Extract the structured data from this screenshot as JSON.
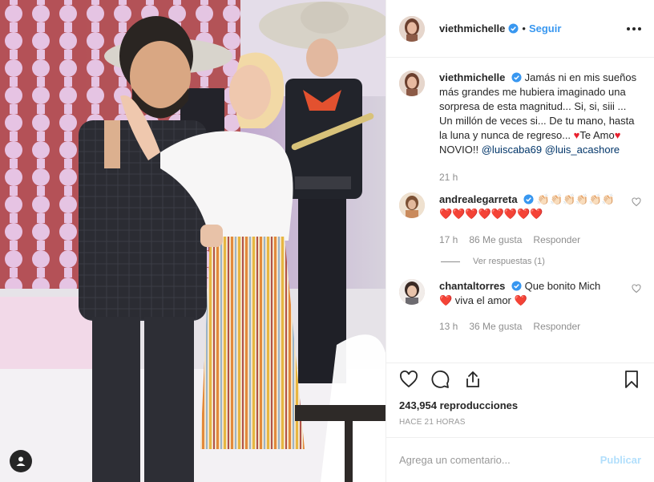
{
  "post": {
    "username": "viethmichelle",
    "follow_label": "Seguir",
    "dot": "•"
  },
  "caption": {
    "username": "viethmichelle",
    "text_1": "Jamás ni en mis sueños más grandes me hubiera imaginado una sorpresa de esta magnitud... Si, si, siii ... Un millón de veces si... De tu mano, hasta la luna y nunca de regreso... ",
    "heart_1": "♥",
    "text_2": "Te Amo",
    "heart_2": "♥",
    "text_3": " NOVIO!! ",
    "mention_1": "@luiscaba69",
    "mention_2": "@luis_acashore",
    "time": "21 h"
  },
  "comments": [
    {
      "username": "andrealegarreta",
      "text": "👏🏻👏🏻👏🏻👏🏻👏🏻👏🏻❤️❤️❤️❤️❤️❤️❤️❤️",
      "time": "17 h",
      "likes": "86 Me gusta",
      "reply_label": "Responder",
      "view_replies": "Ver respuestas (1)"
    },
    {
      "username": "chantaltorres",
      "text_1": "Que bonito Mich",
      "heart": "❤️",
      "text_2": " viva el amor ",
      "heart_2": "❤️",
      "time": "13 h",
      "likes": "36 Me gusta",
      "reply_label": "Responder"
    }
  ],
  "stats": {
    "views": "243,954 reproducciones",
    "posted": "HACE 21 HORAS"
  },
  "add_comment": {
    "placeholder": "Agrega un comentario...",
    "publish_label": "Publicar"
  },
  "icons": {
    "like": "heart-outline-icon",
    "comment": "comment-icon",
    "share": "share-icon",
    "save": "bookmark-icon",
    "more": "more-horizontal-icon",
    "user_tag": "user-tag-icon",
    "verified": "verified-badge-icon"
  },
  "colors": {
    "link_blue": "#3897f0",
    "publish_disabled": "#b2dffc",
    "mention": "#003569",
    "heart_red": "#e8212e",
    "muted": "#8e8e8e"
  }
}
